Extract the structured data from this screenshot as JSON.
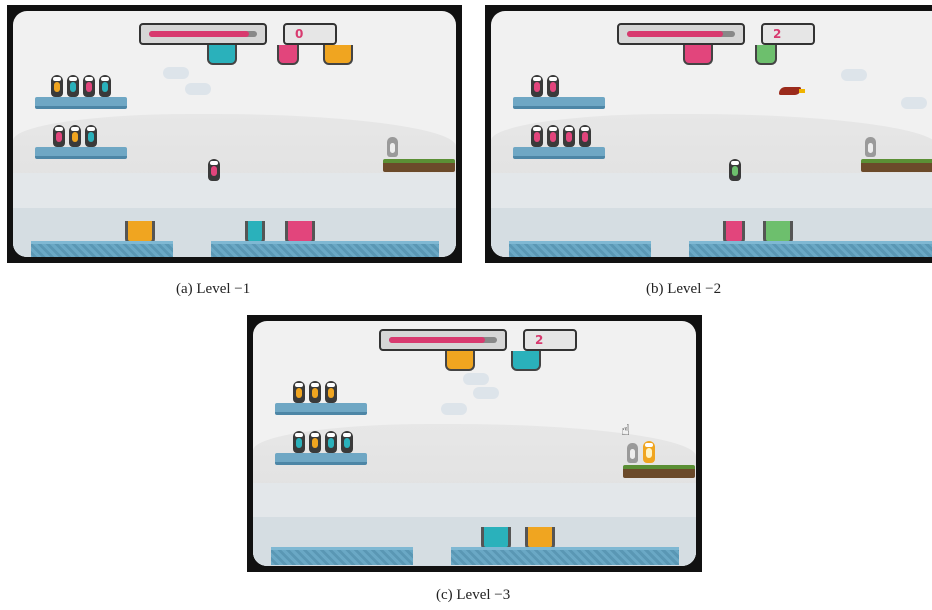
{
  "panels": [
    {
      "caption": "(a)  Level −1",
      "score": "0",
      "progress": 0.92,
      "dispensers": [
        "#2ab1bb",
        "#e2457c",
        "#f0a520"
      ],
      "shelf_top": [
        "#f0a520",
        "#2ab1bb",
        "#e2457c",
        "#2ab1bb"
      ],
      "shelf_bottom": [
        "#e2457c",
        "#f0a520",
        "#2ab1bb"
      ],
      "buckets": [
        "#f0a520",
        "#2ab1bb",
        "#e2457c"
      ],
      "falling_penguin": "#e2457c"
    },
    {
      "caption": "(b)  Level −2",
      "score": "2",
      "progress": 0.9,
      "dispensers": [
        "#e2457c",
        "#6dbf6d"
      ],
      "shelf_top": [
        "#e2457c",
        "#e2457c"
      ],
      "shelf_bottom": [
        "#e2457c",
        "#e2457c",
        "#e2457c",
        "#e2457c"
      ],
      "buckets": [
        "#e2457c",
        "#6dbf6d"
      ],
      "falling_penguin": "#6dbf6d"
    },
    {
      "caption": "(c)  Level −3",
      "score": "2",
      "progress": 0.9,
      "dispensers": [
        "#f0a520",
        "#2ab1bb"
      ],
      "shelf_top": [
        "#f0a520",
        "#f0a520",
        "#f0a520"
      ],
      "shelf_bottom": [
        "#2ab1bb",
        "#f0a520",
        "#2ab1bb",
        "#2ab1bb"
      ],
      "buckets": [
        "#2ab1bb",
        "#f0a520"
      ],
      "falling_penguin": ""
    }
  ],
  "icons": {
    "hand": "hand-pointer-icon",
    "bird": "bird-icon"
  }
}
